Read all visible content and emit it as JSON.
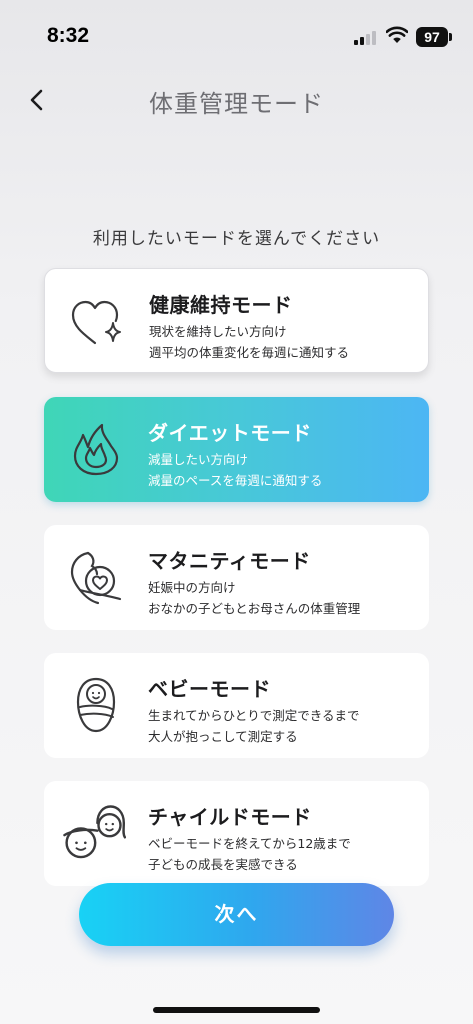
{
  "status_bar": {
    "time": "8:32",
    "battery": "97"
  },
  "header": {
    "title": "体重管理モード"
  },
  "subtitle": "利用したいモードを選んでください",
  "modes": [
    {
      "title": "健康維持モード",
      "desc1": "現状を維持したい方向け",
      "desc2": "週平均の体重変化を毎週に通知する",
      "icon": "heart-sparkle-icon"
    },
    {
      "title": "ダイエットモード",
      "desc1": "減量したい方向け",
      "desc2": "減量のペースを毎週に通知する",
      "icon": "flame-icon",
      "selected": true
    },
    {
      "title": "マタニティモード",
      "desc1": "妊娠中の方向け",
      "desc2": "おなかの子どもとお母さんの体重管理",
      "icon": "pregnancy-icon"
    },
    {
      "title": "ベビーモード",
      "desc1": "生まれてからひとりで測定できるまで",
      "desc2": "大人が抱っこして測定する",
      "icon": "swaddled-baby-icon"
    },
    {
      "title": "チャイルドモード",
      "desc1": "ベビーモードを終えてから12歳まで",
      "desc2": "子どもの成長を実感できる",
      "icon": "children-icon"
    }
  ],
  "next_button": {
    "label": "次へ"
  },
  "colors": {
    "selected_gradient_start": "#3fd6b7",
    "selected_gradient_end": "#4cb6f4",
    "button_gradient_start": "#18d2f5",
    "button_gradient_end": "#5f86e6"
  }
}
